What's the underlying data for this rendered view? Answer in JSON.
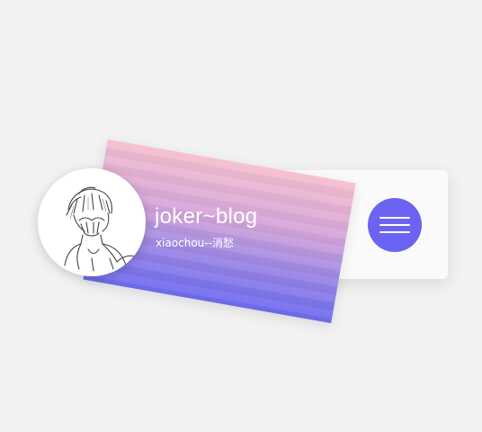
{
  "profile": {
    "title": "joker~blog",
    "subtitle": "xiaochou--消愁"
  },
  "avatar": {
    "icon": "sketch-person-covering-face"
  },
  "menu": {
    "icon": "hamburger-menu-icon"
  },
  "colors": {
    "background": "#f2f2f2",
    "gradient_top": "#f6bfd0",
    "gradient_bottom": "#6e6cf0",
    "menu_button": "#6b63f2",
    "panel": "#fafafa"
  }
}
